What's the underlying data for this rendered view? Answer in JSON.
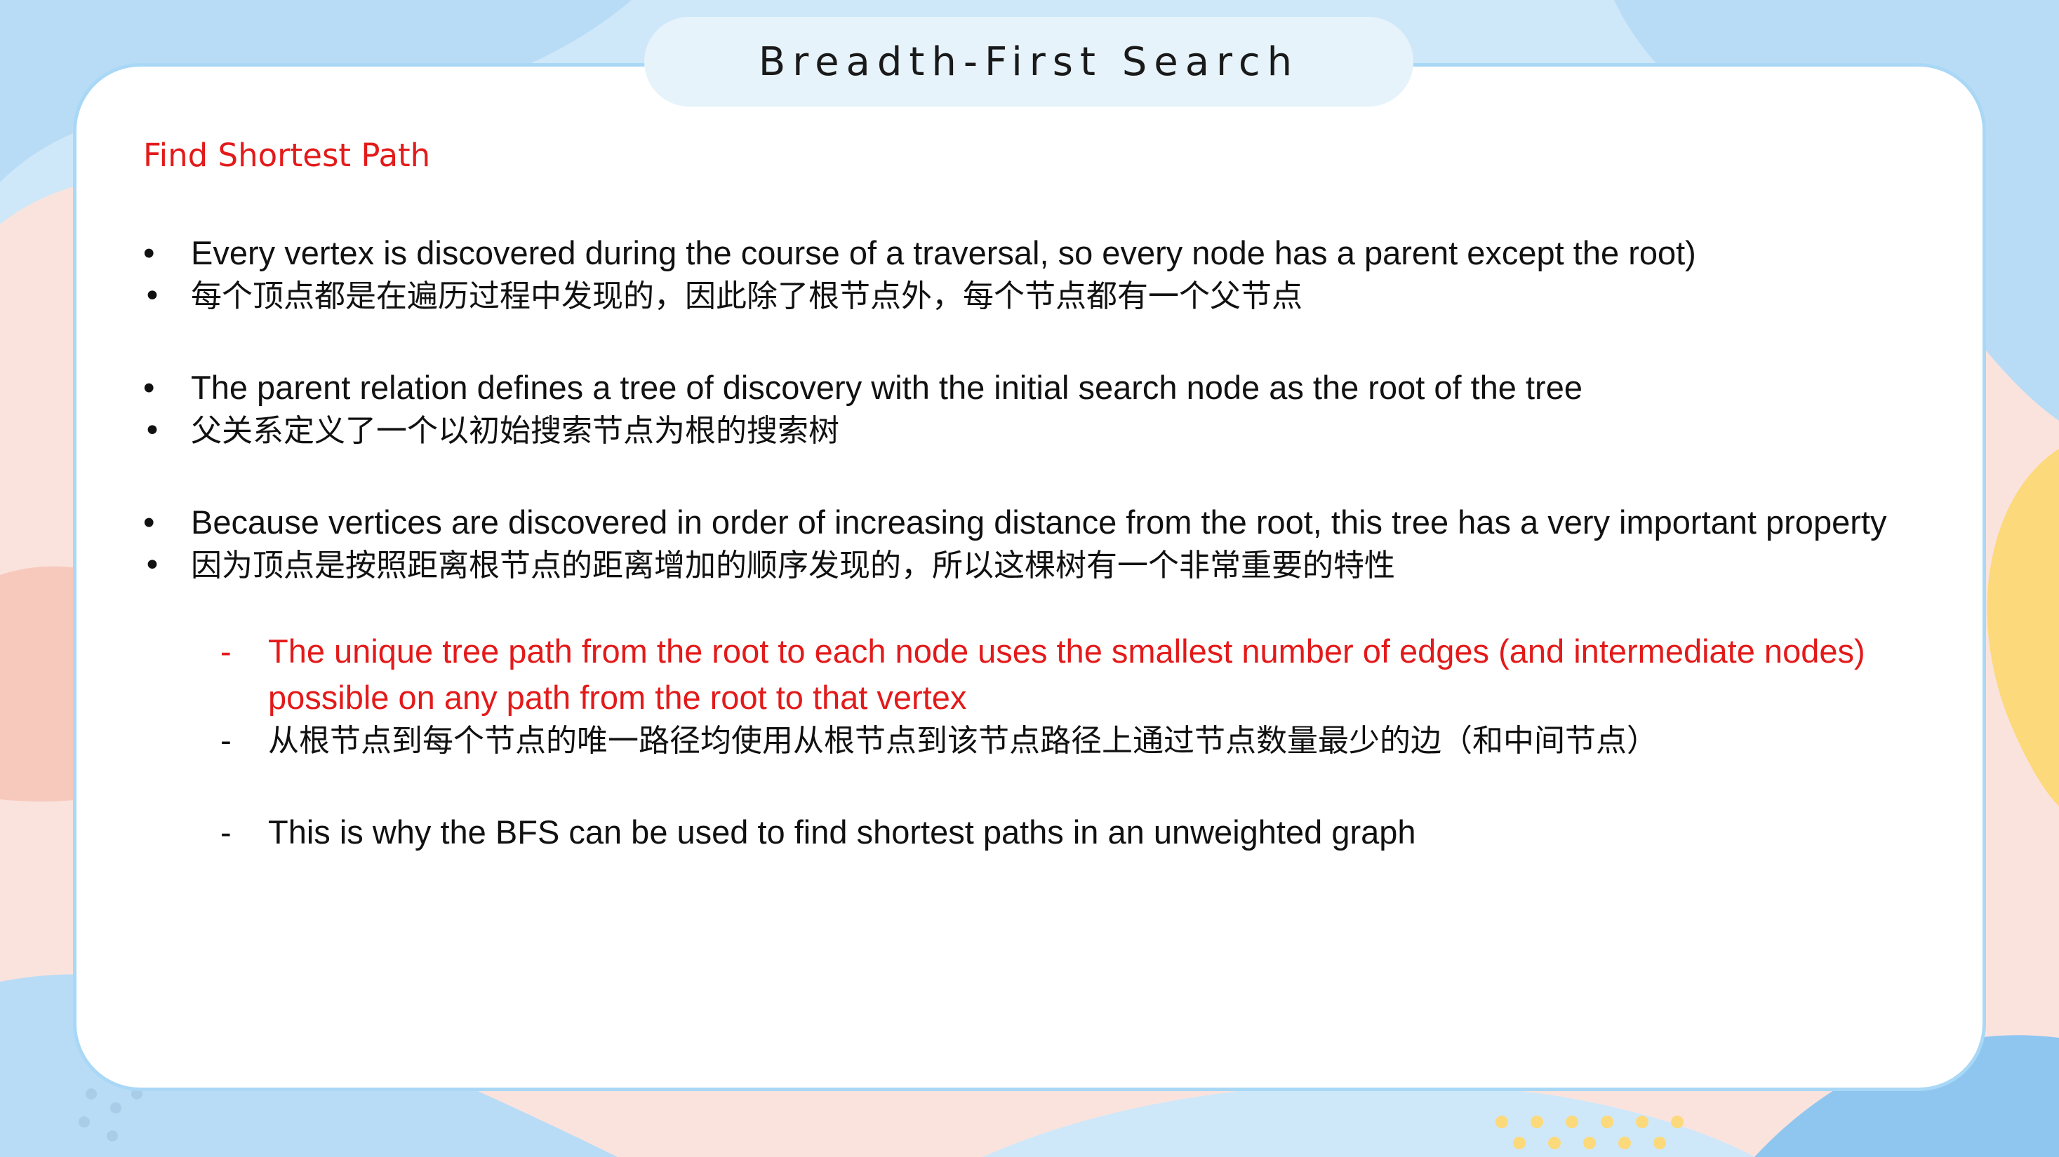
{
  "slide": {
    "title": "Breadth-First Search",
    "heading": "Find Shortest Path"
  },
  "bullets": {
    "b1_en": "Every vertex is discovered during the course of a traversal, so every node has a parent except the root)",
    "b1_cn": "每个顶点都是在遍历过程中发现的，因此除了根节点外，每个节点都有一个父节点",
    "b2_en": "The parent relation defines a tree of discovery with the initial search node as the root of the tree",
    "b2_cn": "父关系定义了一个以初始搜索节点为根的搜索树",
    "b3_en": "Because vertices are discovered in order of increasing distance from the root, this tree has a very important property",
    "b3_cn": "因为顶点是按照距离根节点的距离增加的顺序发现的，所以这棵树有一个非常重要的特性"
  },
  "subitems": {
    "s1_en": "The unique tree path from the root to each node uses the smallest number of edges (and intermediate nodes) possible on any path from the root to that vertex",
    "s1_cn": "从根节点到每个节点的唯一路径均使用从根节点到该节点路径上通过节点数量最少的边（和中间节点）",
    "s2_en": "This is why the BFS can be used to find shortest paths in an unweighted graph"
  },
  "markers": {
    "bullet": "•",
    "dash": "-"
  },
  "colors": {
    "accent_red": "#e31a1a",
    "card_border": "#a9d8f6",
    "title_pill": "#e6f3fb",
    "bg_blue": "#bfe0f7",
    "bg_peach": "#fbe3dd",
    "bg_yellow": "#fcd97a"
  }
}
